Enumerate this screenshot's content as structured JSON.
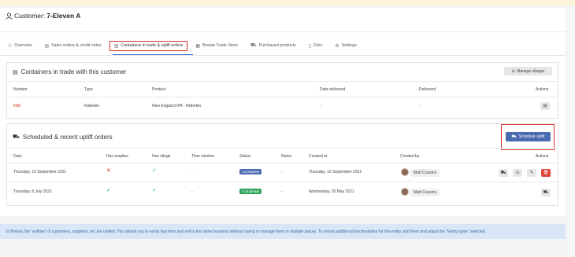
{
  "customer": {
    "label": "Customer:",
    "name": "7-Eleven A"
  },
  "tabs": [
    {
      "label": "Overview",
      "icon": "user-icon"
    },
    {
      "label": "Sales orders & credit notes",
      "icon": "document-icon"
    },
    {
      "label": "Containers in trade & uplift orders",
      "icon": "barrel-icon",
      "active": true
    },
    {
      "label": "Breww Trade Store",
      "icon": "store-icon"
    },
    {
      "label": "Purchased products",
      "icon": "cart-icon"
    },
    {
      "label": "Files",
      "icon": "file-icon"
    },
    {
      "label": "Settings",
      "icon": "gears-icon"
    }
  ],
  "containers": {
    "title": "Containers in trade with this customer",
    "manage_button": "Manage ullages",
    "headers": {
      "number": "Number",
      "type": "Type",
      "product": "Product",
      "date_delivered": "Date delivered",
      "delivered": "Delivered",
      "actions": "Actions"
    },
    "rows": [
      {
        "number": "K88",
        "type": "Kilderkin",
        "product": "New England IPA - Kilderkin",
        "date_delivered": "-",
        "delivered": "-"
      }
    ]
  },
  "uplift": {
    "title": "Scheduled & recent uplift orders",
    "schedule_button": "Schedule uplift",
    "headers": {
      "date": "Date",
      "has_empties": "Has empties",
      "has_ullage": "Has ullage",
      "time_window": "Time window",
      "status": "Status",
      "notes": "Notes",
      "created_at": "Created at",
      "created_by": "Created by",
      "actions": "Actions"
    },
    "rows": [
      {
        "date": "Thursday, 16 September 2021",
        "has_empties": "✕",
        "has_ullage": "✓",
        "time_window": "-",
        "status": "Incomplete",
        "status_color": "#4a6bb0",
        "notes": "-",
        "created_at": "Thursday, 16 September 2021",
        "created_by": "Matt Cousins"
      },
      {
        "date": "Thursday, 8 July 2021",
        "has_empties": "✓",
        "has_ullage": "✓",
        "time_window": "-",
        "status": "Completed",
        "status_color": "#2da35a",
        "notes": "-",
        "created_at": "Wednesday, 26 May 2021",
        "created_by": "Matt Cousins"
      }
    ]
  },
  "info_text": "In Breww, the \"entities\" of customers, suppliers, etc are unified. This allows you to easily buy from and sell to the same business without having to manage them in multiple places. To unlock additional functionalities for this entity, edit them and adjust the \"Entity types\" selected."
}
